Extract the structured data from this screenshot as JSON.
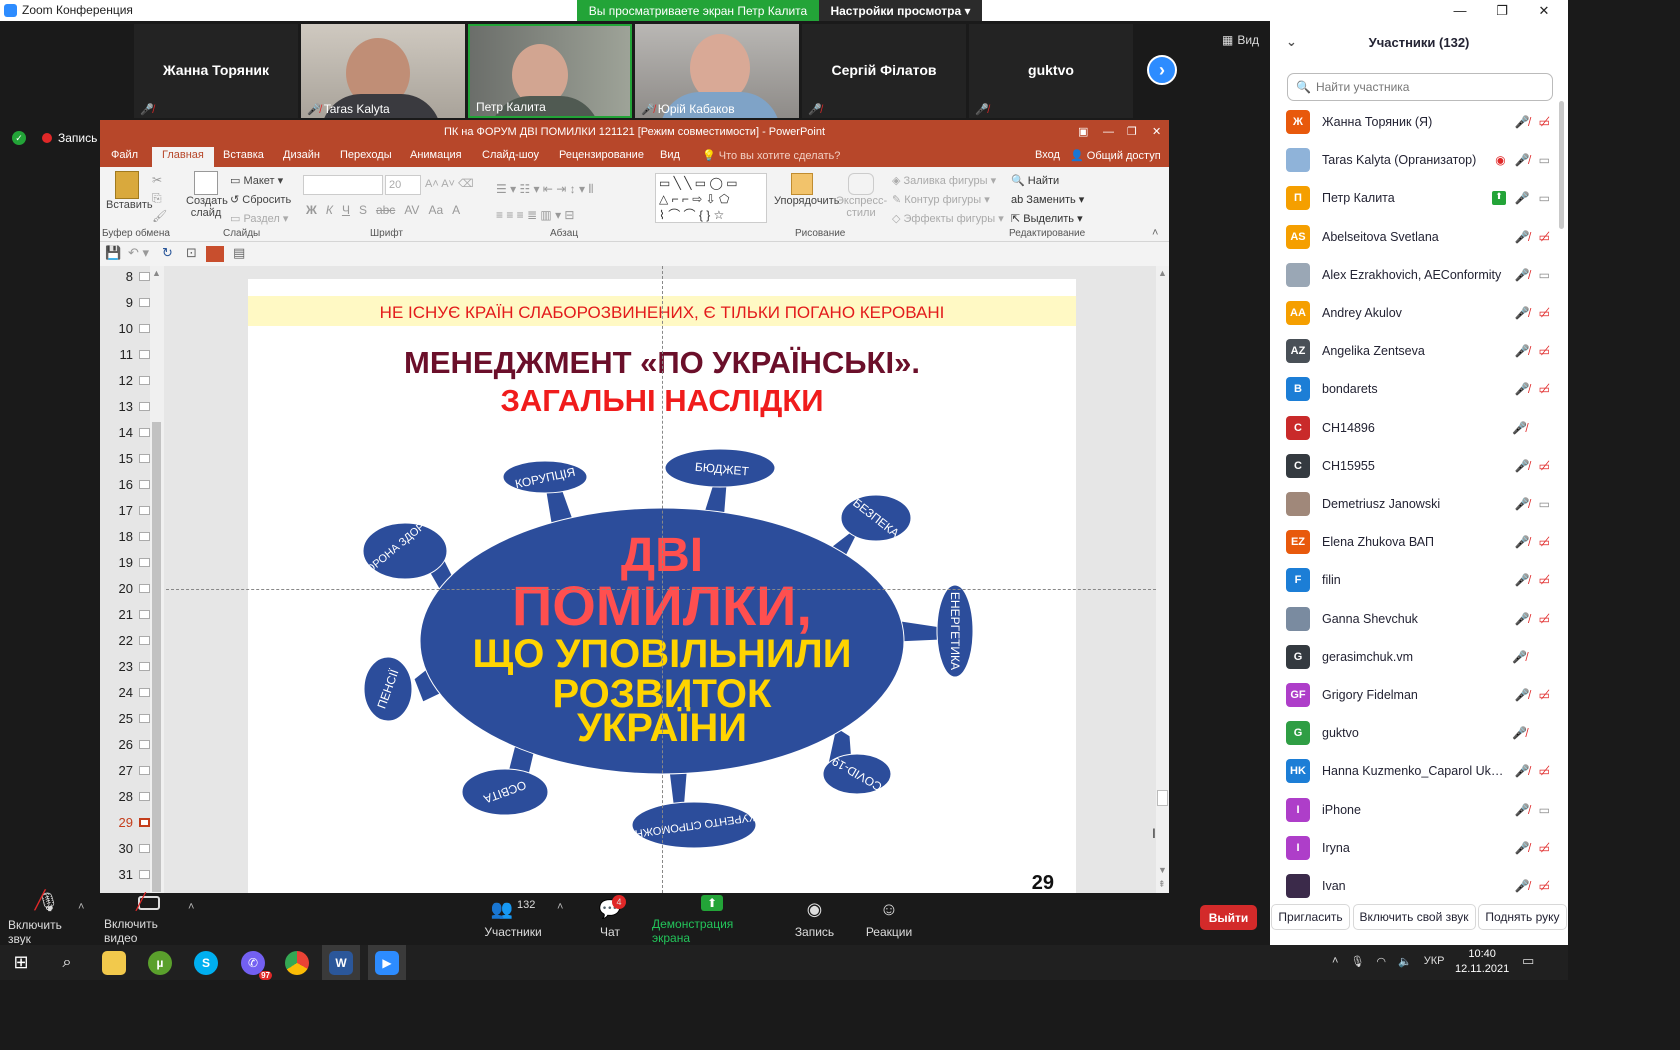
{
  "window": {
    "title": "Zoom Конференция",
    "viewing_banner": "Вы просматриваете экран Петр Калита",
    "view_options": "Настройки просмотра"
  },
  "video_strip": {
    "tiles": [
      {
        "name": "Жанна Торяник",
        "video": false
      },
      {
        "name": "Taras Kalyta",
        "video": true
      },
      {
        "name": "Петр Калита",
        "video": true
      },
      {
        "name": "Юрій Кабаков",
        "video": true
      },
      {
        "name": "Сергій Філатов",
        "video": false
      },
      {
        "name": "guktvo",
        "video": false
      }
    ],
    "view_label": "Вид"
  },
  "recording": {
    "label": "Запись"
  },
  "powerpoint": {
    "title": "ПК на ФОРУМ ДВІ ПОМИЛКИ 121121 [Режим совместимости] - PowerPoint",
    "tabs": [
      "Файл",
      "Главная",
      "Вставка",
      "Дизайн",
      "Переходы",
      "Анимация",
      "Слайд-шоу",
      "Рецензирование",
      "Вид"
    ],
    "tell_me": "Что вы хотите сделать?",
    "signin": "Вход",
    "share": "Общий доступ",
    "ribbon": {
      "clipboard": {
        "paste": "Вставить",
        "group": "Буфер обмена"
      },
      "slides": {
        "new_slide": "Создать слайд",
        "layout": "Макет",
        "reset": "Сбросить",
        "section": "Раздел",
        "group": "Слайды"
      },
      "font": {
        "size": "20",
        "bold": "Ж",
        "italic": "К",
        "underline": "Ч",
        "shadow": "S",
        "strike": "abc",
        "spacing": "AV",
        "case": "Aa",
        "color": "A",
        "group": "Шрифт"
      },
      "paragraph": {
        "group": "Абзац"
      },
      "drawing": {
        "arrange": "Упорядочить",
        "styles": "Экспресс-стили",
        "fill": "Заливка фигуры",
        "outline": "Контур фигуры",
        "effects": "Эффекты фигуры",
        "group": "Рисование"
      },
      "editing": {
        "find": "Найти",
        "replace": "Заменить",
        "select": "Выделить",
        "group": "Редактирование"
      }
    },
    "thumbnails": [
      8,
      9,
      10,
      11,
      12,
      13,
      14,
      15,
      16,
      17,
      18,
      19,
      20,
      21,
      22,
      23,
      24,
      25,
      26,
      27,
      28,
      29,
      30,
      31
    ],
    "current_slide": 29,
    "slide": {
      "banner": "НЕ ІСНУЄ КРАЇН СЛАБОРОЗВИНЕНИХ, Є ТІЛЬКИ ПОГАНО КЕРОВАНІ",
      "title1": "МЕНЕДЖМЕНТ «ПО УКРАЇНСЬКІ».",
      "title2": "ЗАГАЛЬНІ НАСЛІДКИ",
      "center_red1": "ДВІ",
      "center_red2": "ПОМИЛКИ,",
      "center_yellow": [
        "ЩО УПОВІЛЬНИЛИ",
        "РОЗВИТОК",
        "УКРАЇНИ"
      ],
      "spikes": [
        "КОРУПЦІЯ",
        "БЮДЖЕТ",
        "БЕЗПЕКА",
        "ОХОРОНА ЗДОРОВ'Я",
        "ЕНЕРГЕТИКА",
        "ПЕНСІЇ",
        "COVID-19",
        "ОСВІТА",
        "КОНКУРЕНТО СПРОМОЖНІСТЬ"
      ],
      "page_number": "29"
    }
  },
  "toolbar": {
    "unmute": "Включить звук",
    "start_video": "Включить видео",
    "participants": "Участники",
    "participants_count": "132",
    "chat": "Чат",
    "chat_badge": "4",
    "share": "Демонстрация экрана",
    "record": "Запись",
    "reactions": "Реакции",
    "leave": "Выйти"
  },
  "participants_panel": {
    "title": "Участники (132)",
    "search_placeholder": "Найти участника",
    "list": [
      {
        "initials": "Ж",
        "name": "Жанна Торяник (Я)",
        "color": "#e8590c",
        "mic": "off",
        "video": "off"
      },
      {
        "initials": "",
        "name": "Taras Kalyta (Организатор)",
        "color": "#8fb3d9",
        "mic": "off",
        "video": "on",
        "rec": true
      },
      {
        "initials": "П",
        "name": "Петр Калита",
        "color": "#f59f00",
        "mic": "on",
        "video": "on",
        "share": true
      },
      {
        "initials": "AS",
        "name": "Abelseitova Svetlana",
        "color": "#f59f00",
        "mic": "off",
        "video": "off"
      },
      {
        "initials": "",
        "name": "Alex Ezrakhovich, AEConformity",
        "color": "#9aa7b5",
        "mic": "off",
        "video": "on"
      },
      {
        "initials": "AA",
        "name": "Andrey Akulov",
        "color": "#f59f00",
        "mic": "off",
        "video": "off"
      },
      {
        "initials": "AZ",
        "name": "Angelika Zentseva",
        "color": "#495057",
        "mic": "off",
        "video": "off"
      },
      {
        "initials": "B",
        "name": "bondarets",
        "color": "#1c7ed6",
        "mic": "off",
        "video": "off"
      },
      {
        "initials": "C",
        "name": "CH14896",
        "color": "#c92a2a",
        "mic": "off",
        "video": "none"
      },
      {
        "initials": "C",
        "name": "CH15955",
        "color": "#343a40",
        "mic": "off",
        "video": "off"
      },
      {
        "initials": "",
        "name": "Demetriusz Janowski",
        "color": "#a0887a",
        "mic": "off",
        "video": "on"
      },
      {
        "initials": "EZ",
        "name": "Elena Zhukova ВАП",
        "color": "#e8590c",
        "mic": "off",
        "video": "off"
      },
      {
        "initials": "F",
        "name": "filin",
        "color": "#1c7ed6",
        "mic": "off",
        "video": "off"
      },
      {
        "initials": "",
        "name": "Ganna Shevchuk",
        "color": "#7a8ba0",
        "mic": "off",
        "video": "off"
      },
      {
        "initials": "G",
        "name": "gerasimchuk.vm",
        "color": "#343a40",
        "mic": "off",
        "video": "none"
      },
      {
        "initials": "GF",
        "name": "Grigory Fidelman",
        "color": "#ae3ec9",
        "mic": "off",
        "video": "off"
      },
      {
        "initials": "G",
        "name": "guktvo",
        "color": "#2f9e44",
        "mic": "off",
        "video": "none"
      },
      {
        "initials": "HK",
        "name": "Hanna Kuzmenko_Caparol Ukrai...",
        "color": "#1c7ed6",
        "mic": "off",
        "video": "off"
      },
      {
        "initials": "I",
        "name": "iPhone",
        "color": "#ae3ec9",
        "mic": "off",
        "video": "on"
      },
      {
        "initials": "I",
        "name": "Iryna",
        "color": "#ae3ec9",
        "mic": "off",
        "video": "off"
      },
      {
        "initials": "",
        "name": "Ivan",
        "color": "#3b2a4a",
        "mic": "off",
        "video": "off"
      }
    ],
    "invite": "Пригласить",
    "unmute_me": "Включить свой звук",
    "raise_hand": "Поднять руку"
  },
  "taskbar": {
    "lang": "УКР",
    "time": "10:40",
    "date": "12.11.2021",
    "viber_badge": "97"
  }
}
